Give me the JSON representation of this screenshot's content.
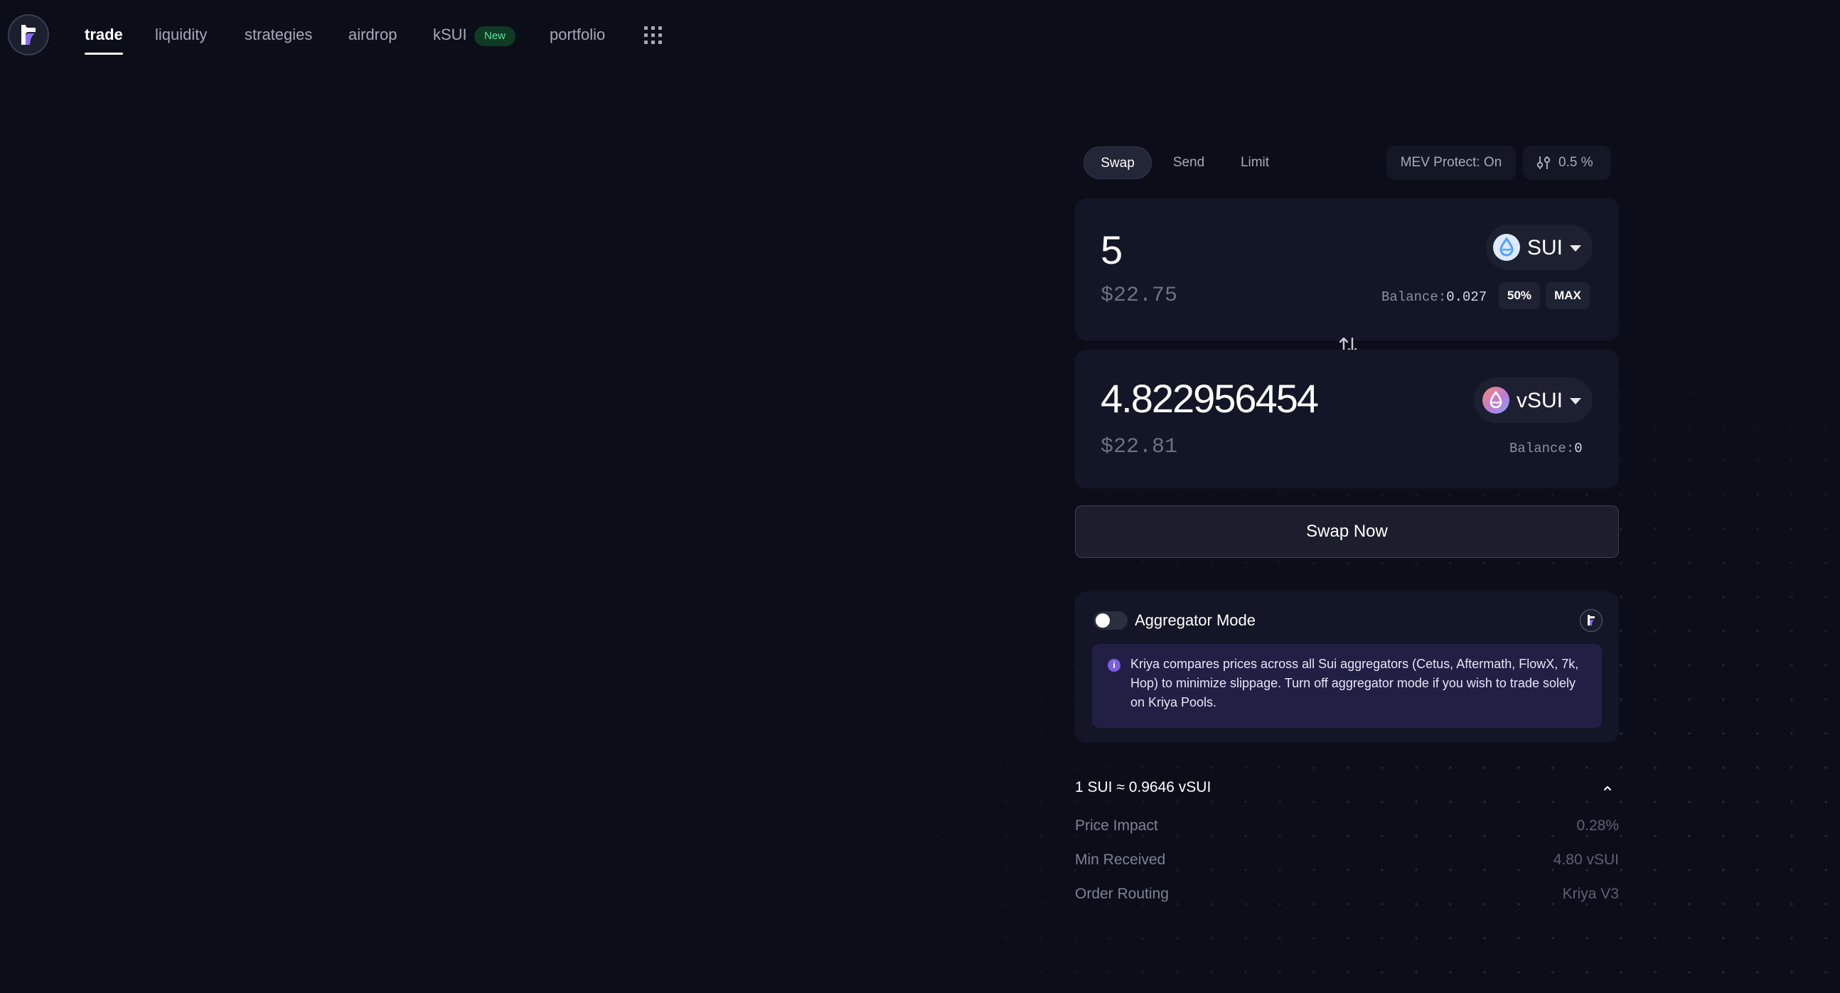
{
  "nav": {
    "items": [
      {
        "label": "trade",
        "active": true
      },
      {
        "label": "liquidity"
      },
      {
        "label": "strategies"
      },
      {
        "label": "airdrop"
      },
      {
        "label": "kSUI"
      },
      {
        "label": "portfolio"
      }
    ],
    "new_badge": "New",
    "apps_icon": "grid-icon",
    "logo_icon": "kriya-logo"
  },
  "tabs": {
    "swap": "Swap",
    "send": "Send",
    "limit": "Limit",
    "mev": "MEV Protect: On",
    "slippage": "0.5 %",
    "settings_icon": "sliders-icon"
  },
  "from": {
    "amount": "5",
    "usd": "$22.75",
    "token": "SUI",
    "balance_label": "Balance:",
    "balance_value": "0.027",
    "half_label": "50%",
    "max_label": "MAX"
  },
  "to": {
    "amount": "4.822956454",
    "usd": "$22.81",
    "token": "vSUI",
    "balance_label": "Balance:",
    "balance_value": "0"
  },
  "swap_button": "Swap Now",
  "aggregator": {
    "title": "Aggregator Mode",
    "enabled": false,
    "info": "Kriya compares prices across all Sui aggregators (Cetus, Aftermath, FlowX, 7k, Hop) to minimize slippage. Turn off aggregator mode if you wish to trade solely on Kriya Pools."
  },
  "details": {
    "rate": "1 SUI ≈ 0.9646 vSUI",
    "rows": [
      {
        "label": "Price Impact",
        "value": "0.28%"
      },
      {
        "label": "Min Received",
        "value": "4.80 vSUI"
      },
      {
        "label": "Order Routing",
        "value": "Kriya V3"
      }
    ]
  },
  "colors": {
    "background": "#0b0e19",
    "card": "#121626",
    "accent_new": "#5fe3a0",
    "info_bg": "#221f45"
  }
}
